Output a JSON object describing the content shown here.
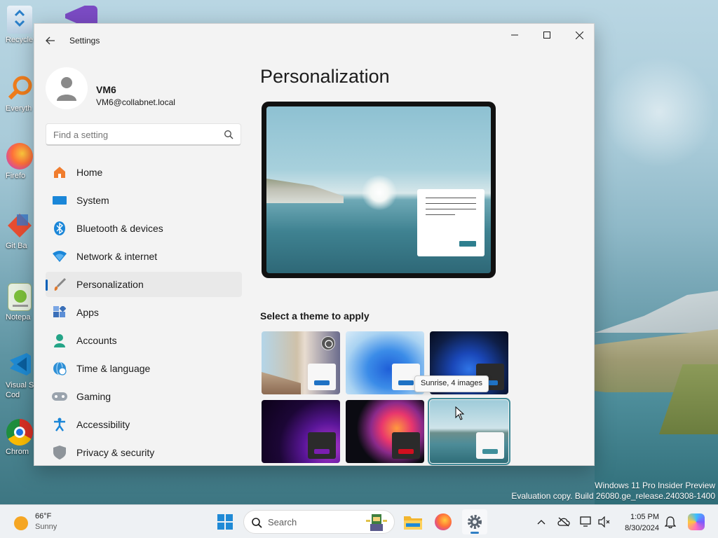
{
  "desktop": {
    "icons": [
      {
        "label": "Recycle",
        "icon": "recycle-bin-icon"
      },
      {
        "label": "Everyth",
        "icon": "everything-search-icon"
      },
      {
        "label": "Firefo",
        "icon": "firefox-icon"
      },
      {
        "label": "Git Ba",
        "icon": "git-bash-icon"
      },
      {
        "label": "Notepa",
        "icon": "notepad-plus-plus-icon"
      },
      {
        "label": "Visual St\nCod",
        "icon": "vscode-icon"
      },
      {
        "label": "Chrom",
        "icon": "chrome-icon"
      }
    ],
    "watermark": {
      "line1": "Windows 11 Pro Insider Preview",
      "line2": "Evaluation copy. Build 26080.ge_release.240308-1400"
    }
  },
  "window": {
    "title": "Settings",
    "controls": {
      "minimize": "minimize-icon",
      "maximize": "maximize-icon",
      "close": "close-icon"
    }
  },
  "profile": {
    "name": "VM6",
    "email": "VM6@collabnet.local"
  },
  "search": {
    "placeholder": "Find a setting"
  },
  "nav": {
    "items": [
      {
        "label": "Home",
        "icon": "home-icon"
      },
      {
        "label": "System",
        "icon": "system-icon"
      },
      {
        "label": "Bluetooth & devices",
        "icon": "bluetooth-icon"
      },
      {
        "label": "Network & internet",
        "icon": "network-icon"
      },
      {
        "label": "Personalization",
        "icon": "brush-icon",
        "active": true
      },
      {
        "label": "Apps",
        "icon": "apps-icon"
      },
      {
        "label": "Accounts",
        "icon": "accounts-icon"
      },
      {
        "label": "Time & language",
        "icon": "globe-clock-icon"
      },
      {
        "label": "Gaming",
        "icon": "gamepad-icon"
      },
      {
        "label": "Accessibility",
        "icon": "accessibility-icon"
      },
      {
        "label": "Privacy & security",
        "icon": "shield-icon"
      }
    ]
  },
  "content": {
    "title": "Personalization",
    "theme_section_label": "Select a theme to apply",
    "themes": [
      {
        "id": "custom",
        "selected": false
      },
      {
        "id": "windows-light",
        "selected": false
      },
      {
        "id": "windows-dark",
        "selected": false
      },
      {
        "id": "glow",
        "selected": false
      },
      {
        "id": "captured-motion",
        "selected": false
      },
      {
        "id": "sunrise",
        "selected": true
      }
    ],
    "tooltip": "Sunrise, 4 images"
  },
  "taskbar": {
    "weather": {
      "temp": "66°F",
      "condition": "Sunny"
    },
    "search_label": "Search",
    "clock": {
      "time": "1:05 PM",
      "date": "8/30/2024"
    },
    "accent": "#2f7fc4"
  }
}
